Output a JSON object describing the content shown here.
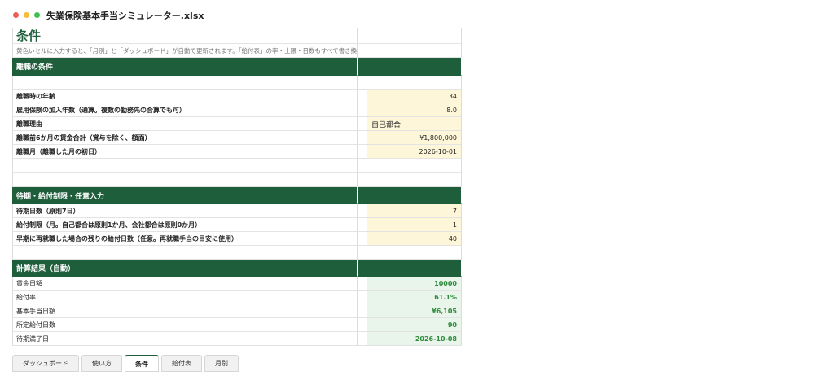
{
  "window": {
    "title": "失業保険基本手当シミュレーター.xlsx"
  },
  "sheet": {
    "title": "条件",
    "note": "黄色いセルに入力すると、「月別」と「ダッシュボード」が自動で更新されます。「給付表」の率・上限・日数もすべて書き換えられます。",
    "section1": "離職の条件",
    "section2": "待期・給付制限・任意入力",
    "section3": "計算結果（自動）",
    "rows": [
      {
        "label": "離職時の年齢",
        "value": "34"
      },
      {
        "label": "雇用保険の加入年数（通算。複数の勤務先の合算でも可）",
        "value": "8.0"
      },
      {
        "label": "離職理由",
        "value": "自己都合"
      },
      {
        "label": "離職前6か月の賃金合計（賞与を除く、額面）",
        "value": "¥1,800,000"
      },
      {
        "label": "離職月（離職した月の初日）",
        "value": "2026-10-01"
      },
      {
        "label": "待期日数（原則7日）",
        "value": "7"
      },
      {
        "label": "給付制限（月。自己都合は原則1か月、会社都合は原則0か月）",
        "value": "1"
      },
      {
        "label": "早期に再就職した場合の残りの給付日数（任意。再就職手当の目安に使用）",
        "value": "40"
      }
    ],
    "results": [
      {
        "label": "賃金日額",
        "value": "10000"
      },
      {
        "label": "給付率",
        "value": "61.1%"
      },
      {
        "label": "基本手当日額",
        "value": "¥6,105"
      },
      {
        "label": "所定給付日数",
        "value": "90"
      },
      {
        "label": "待期満了日",
        "value": "2026-10-08"
      }
    ]
  },
  "tabs": [
    "ダッシュボード",
    "使い方",
    "条件",
    "給付表",
    "月別"
  ],
  "colors": {
    "accent": "#1e5e3b",
    "input": "#fdf6d8",
    "result": "#2e8b3c"
  }
}
